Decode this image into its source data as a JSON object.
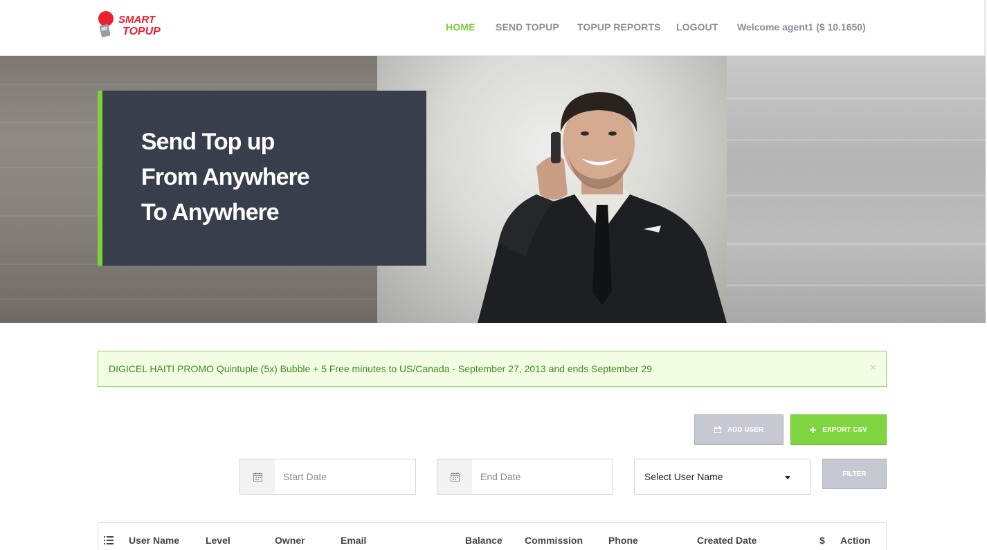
{
  "brand": {
    "name_line1": "SMART",
    "name_line2": "TOPUP",
    "color": "#e8202f"
  },
  "nav": {
    "items": [
      {
        "label": "HOME",
        "active": true
      },
      {
        "label": "SEND TOPUP",
        "active": false
      },
      {
        "label": "TOPUP REPORTS",
        "active": false
      },
      {
        "label": "LOGOUT",
        "active": false
      }
    ],
    "welcome": "Welcome agent1 ($ 10.1650)"
  },
  "hero": {
    "lines": [
      "Send Top up",
      "From Anywhere",
      "To Anywhere"
    ],
    "accent": "#7ed13c"
  },
  "alert": {
    "text": "DIGICEL HAITI PROMO Quintuple (5x) Bubble + 5 Free minutes to US/Canada - September 27, 2013 and ends September 29",
    "close_symbol": "×"
  },
  "actions": {
    "add_user": "ADD USER",
    "add_user_icon": "calendar-icon",
    "export_csv": "EXPORT CSV",
    "export_icon": "plus-icon",
    "filter": "FILTER"
  },
  "filters": {
    "start_date": {
      "placeholder": "Start Date",
      "value": ""
    },
    "end_date": {
      "placeholder": "End Date",
      "value": ""
    },
    "user_select": {
      "selected": "Select User Name"
    }
  },
  "table": {
    "columns": [
      "User Name",
      "Level",
      "Owner",
      "Email",
      "Balance",
      "Commission",
      "Phone",
      "Created Date",
      "$",
      "Action"
    ]
  },
  "colors": {
    "green": "#7ed13c",
    "gray_button": "#c6c9d1",
    "dark_box": "#383e4b",
    "nav_text": "#8d8d99"
  }
}
